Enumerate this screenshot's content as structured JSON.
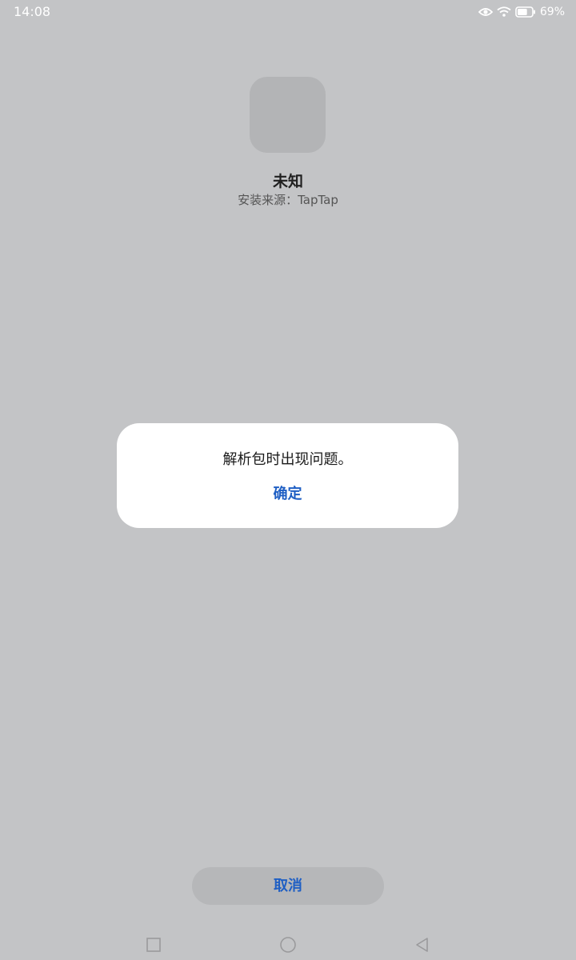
{
  "status_bar": {
    "time": "14:08",
    "battery_percent": "69%",
    "battery_level": 0.69,
    "icons": [
      "eye-icon",
      "wifi-icon",
      "battery-icon"
    ]
  },
  "app": {
    "name": "未知",
    "source": "安装来源：TapTap"
  },
  "dialog": {
    "message": "解析包时出现问题。",
    "confirm_label": "确定"
  },
  "footer": {
    "cancel_label": "取消"
  },
  "nav_bar": {
    "icons": [
      "recents-icon",
      "home-icon",
      "back-icon"
    ]
  },
  "colors": {
    "accent": "#1f5fc4",
    "background": "#c3c4c6",
    "dialog_background": "#ffffff"
  }
}
